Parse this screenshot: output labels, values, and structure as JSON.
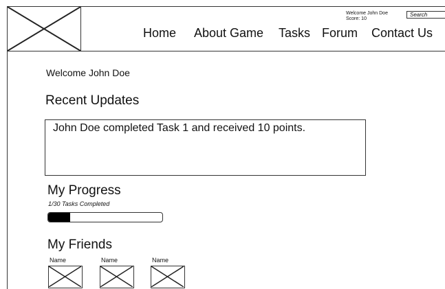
{
  "header": {
    "nav": [
      "Home",
      "About Game",
      "Tasks",
      "Forum",
      "Contact Us"
    ],
    "welcome_user": "Welcome John Doe",
    "score": "Score: 10",
    "search_placeholder": "Search",
    "logo_icon": "image-placeholder-icon"
  },
  "main": {
    "welcome": "Welcome John Doe",
    "recent_updates_title": "Recent Updates",
    "updates": [
      "John Doe completed Task 1 and received 10 points."
    ],
    "progress_title": "My Progress",
    "progress_label": "1/30 Tasks Completed",
    "progress_fraction": 0.19,
    "friends_title": "My Friends",
    "friends": [
      {
        "name": "Name",
        "avatar_icon": "image-placeholder-icon"
      },
      {
        "name": "Name",
        "avatar_icon": "image-placeholder-icon"
      },
      {
        "name": "Name",
        "avatar_icon": "image-placeholder-icon"
      }
    ]
  }
}
